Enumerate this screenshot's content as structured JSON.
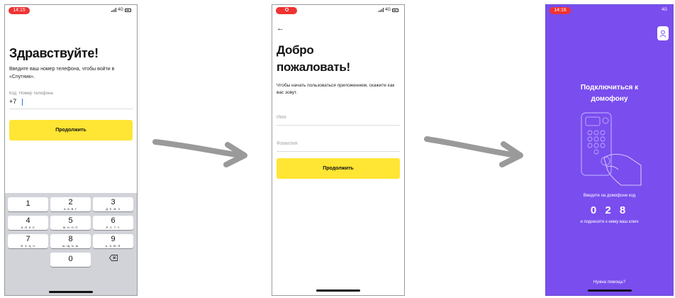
{
  "screen1": {
    "time": "14:15",
    "network": "4G",
    "title": "Здравствуйте!",
    "subtitle": "Введите ваш номер телефона, чтобы войти в «Спутник».",
    "code_label": "Код",
    "phone_label": "Номер телефона",
    "country_code": "+7",
    "continue_label": "Продолжить",
    "keys": [
      {
        "digit": "1",
        "letters": ""
      },
      {
        "digit": "2",
        "letters": "А Б В Г"
      },
      {
        "digit": "3",
        "letters": "Д Е Ж З"
      },
      {
        "digit": "4",
        "letters": "И Й К Л"
      },
      {
        "digit": "5",
        "letters": "М Н О П"
      },
      {
        "digit": "6",
        "letters": "Р С Т У"
      },
      {
        "digit": "7",
        "letters": "Ф Х Ц Ч"
      },
      {
        "digit": "8",
        "letters": "Ш Щ Ъ Ы"
      },
      {
        "digit": "9",
        "letters": "Ь Э Ю Я"
      },
      {
        "digit": "0",
        "letters": ""
      }
    ],
    "backspace_icon": "backspace-icon"
  },
  "screen2": {
    "network": "4G",
    "title_line1": "Добро",
    "title_line2": "пожаловать!",
    "subtitle": "Чтобы начать пользоваться приложением, скажите как вас зовут.",
    "first_name_placeholder": "Имя",
    "last_name_placeholder": "Фамилия",
    "continue_label": "Продолжить"
  },
  "screen3": {
    "time": "14:16",
    "network": "4G",
    "title_line1": "Подключиться к",
    "title_line2": "домофону",
    "instruction": "Введите на домофоне код",
    "code": "0 2 8",
    "hint": "и поднесите к нему ваш ключ",
    "help_label": "Нужна помощь?",
    "profile_icon": "user-icon"
  },
  "colors": {
    "accent_yellow": "#ffe534",
    "accent_purple": "#7a4dee",
    "status_red": "#e33333",
    "arrow_gray": "#9a9a9a"
  }
}
